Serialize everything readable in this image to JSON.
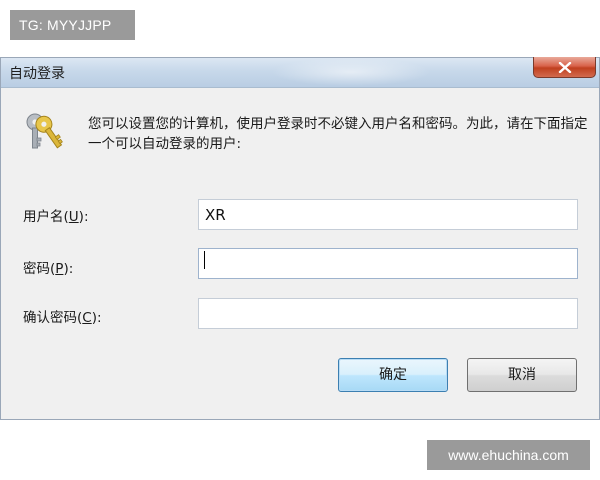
{
  "watermarks": {
    "top": "TG: MYYJJPP",
    "bottom": "www.ehuchina.com"
  },
  "dialog": {
    "title": "自动登录",
    "message": "您可以设置您的计算机，使用户登录时不必键入用户名和密码。为此，请在下面指定一个可以自动登录的用户:",
    "close_icon": "close-icon",
    "fields": {
      "username": {
        "label": "用户名(",
        "mnemonic": "U",
        "suffix": "):",
        "value": "XR"
      },
      "password": {
        "label": "密码(",
        "mnemonic": "P",
        "suffix": "):",
        "value": ""
      },
      "confirm": {
        "label": "确认密码(",
        "mnemonic": "C",
        "suffix": "):",
        "value": ""
      }
    },
    "buttons": {
      "ok": "确定",
      "cancel": "取消"
    },
    "icon": "keys-icon"
  }
}
